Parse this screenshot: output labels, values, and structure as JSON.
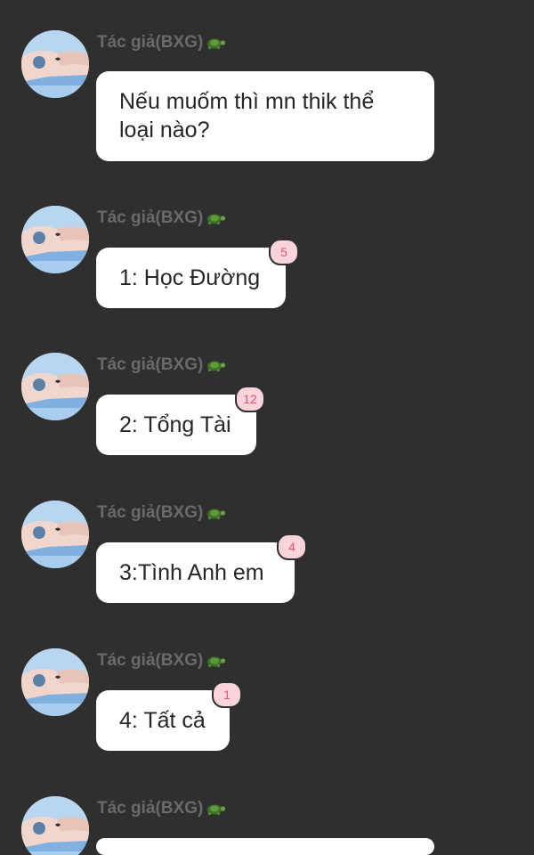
{
  "sender_name": "Tác giả(BXG)",
  "sender_emoji_icon": "turtle-icon",
  "colors": {
    "background": "#2f2f2f",
    "bubble": "#ffffff",
    "sender_text": "#6a6a6a",
    "badge_bg": "#fbd3db",
    "badge_text": "#e0566f"
  },
  "messages": [
    {
      "text_line1": "Nếu muốm thì mn thik thể",
      "text_line2": "loại nào?"
    },
    {
      "text": "1: Học Đường",
      "reaction_count": "5"
    },
    {
      "text": "2: Tổng Tài",
      "reaction_count": "12"
    },
    {
      "text": "3:Tình Anh em",
      "reaction_count": "4"
    },
    {
      "text": "4: Tất cả",
      "reaction_count": "1"
    },
    {
      "text": ""
    }
  ]
}
